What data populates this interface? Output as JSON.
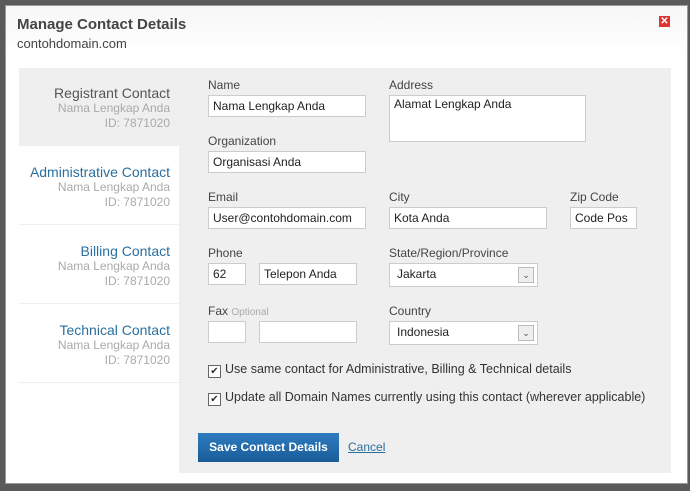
{
  "dialog": {
    "title": "Manage Contact Details",
    "subtitle": "contohdomain.com"
  },
  "tabs": [
    {
      "label": "Registrant Contact",
      "name": "Nama Lengkap Anda",
      "id": "ID: 7871020"
    },
    {
      "label": "Administrative Contact",
      "name": "Nama Lengkap Anda",
      "id": "ID: 7871020"
    },
    {
      "label": "Billing Contact",
      "name": "Nama Lengkap Anda",
      "id": "ID: 7871020"
    },
    {
      "label": "Technical Contact",
      "name": "Nama Lengkap Anda",
      "id": "ID: 7871020"
    }
  ],
  "form": {
    "name_label": "Name",
    "name_value": "Nama Lengkap Anda",
    "address_label": "Address",
    "address_value": "Alamat Lengkap Anda",
    "org_label": "Organization",
    "org_value": "Organisasi Anda",
    "email_label": "Email",
    "email_value": "User@contohdomain.com",
    "city_label": "City",
    "city_value": "Kota Anda",
    "zip_label": "Zip Code",
    "zip_value": "Code Pos",
    "phone_label": "Phone",
    "phone_cc": "62",
    "phone_value": "Telepon Anda",
    "state_label": "State/Region/Province",
    "state_value": "Jakarta",
    "fax_label": "Fax",
    "fax_optional": "Optional",
    "fax_cc": "",
    "fax_value": "",
    "country_label": "Country",
    "country_value": "Indonesia",
    "same_contact": "Use same contact for Administrative, Billing & Technical details",
    "update_all": "Update all Domain Names currently using this contact (wherever applicable)",
    "save": "Save Contact Details",
    "cancel": "Cancel"
  }
}
